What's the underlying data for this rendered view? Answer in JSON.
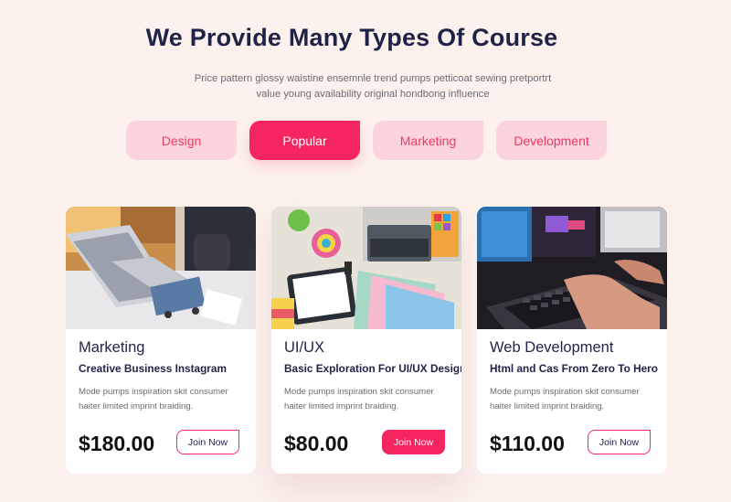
{
  "header": {
    "title": "We Provide Many Types Of Course",
    "subtitle_line1": "Price pattern glossy waistine ensemnle trend pumps petticoat sewing pretportrt",
    "subtitle_line2": "value young availability original hondbong influence"
  },
  "tabs": [
    {
      "label": "Design",
      "active": false
    },
    {
      "label": "Popular",
      "active": true
    },
    {
      "label": "Marketing",
      "active": false
    },
    {
      "label": "Development",
      "active": false
    }
  ],
  "courses": [
    {
      "category": "Marketing",
      "name": "Creative Business Instagram",
      "desc_line1": "Mode pumps inspiration skit consumer",
      "desc_line2": "haiter limited imprint braiding.",
      "price": "$180.00",
      "button": "Join Now",
      "image": "laptop-shopping-cart-photo"
    },
    {
      "category": "UI/UX",
      "name": "Basic Exploration For UI/UX Design",
      "desc_line1": "Mode pumps inspiration skit consumer",
      "desc_line2": "haiter limited imprint braiding.",
      "price": "$80.00",
      "button": "Join Now",
      "image": "color-swatches-tablet-photo"
    },
    {
      "category": "Web Development",
      "name": "Html and Cas From Zero To Hero",
      "desc_line1": "Mode pumps inspiration skit consumer",
      "desc_line2": "haiter limited imprint braiding.",
      "price": "$110.00",
      "button": "Join Now",
      "image": "keyboard-monitor-photo"
    }
  ],
  "colors": {
    "background": "#fcf1ed",
    "accent": "#f5255f",
    "accent_light": "#fcd5dc",
    "heading": "#1f2347"
  }
}
